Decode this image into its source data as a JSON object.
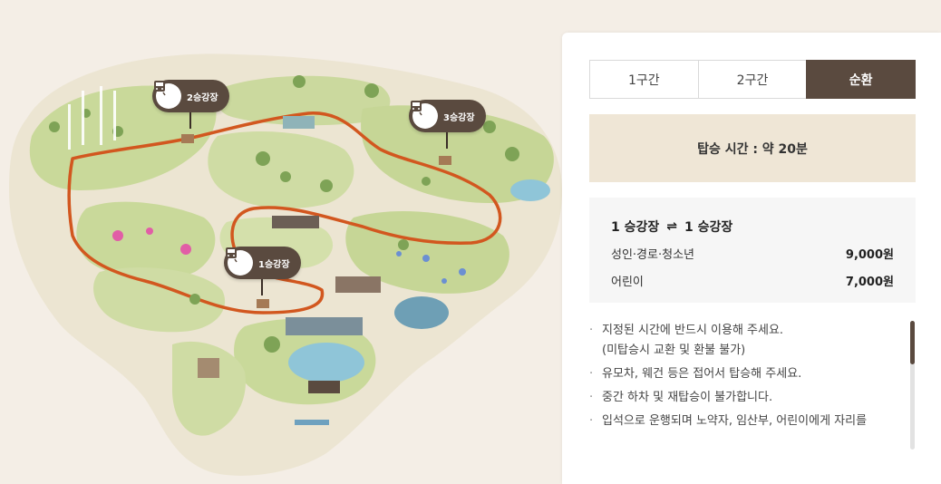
{
  "map": {
    "stations": [
      {
        "label": "2승강장"
      },
      {
        "label": "3승강장"
      },
      {
        "label": "1승강장"
      }
    ]
  },
  "panel": {
    "tabs": [
      {
        "label": "1구간",
        "active": false
      },
      {
        "label": "2구간",
        "active": false
      },
      {
        "label": "순환",
        "active": true
      }
    ],
    "ride_time": "탑승 시간 : 약 20분",
    "fare": {
      "from": "1 승강장",
      "arrow": "⇌",
      "to": "1 승강장",
      "rows": [
        {
          "label": "성인·경로·청소년",
          "price": "9,000원"
        },
        {
          "label": "어린이",
          "price": "7,000원"
        }
      ]
    },
    "notices": [
      {
        "text": "지정된 시간에 반드시 이용해 주세요.",
        "sub": "(미탑승시 교환 및 환불 불가)"
      },
      {
        "text": "유모차, 웨건 등은 접어서 탑승해 주세요.",
        "sub": ""
      },
      {
        "text": "중간 하차 및 재탑승이 불가합니다.",
        "sub": ""
      },
      {
        "text": "입석으로 운행되며 노약자, 임산부, 어린이에게 자리를",
        "sub": ""
      }
    ]
  },
  "colors": {
    "accent": "#5a4a3f",
    "route": "#d2571f",
    "ground": "#e8e2cf",
    "grass": "#c9d99a"
  }
}
